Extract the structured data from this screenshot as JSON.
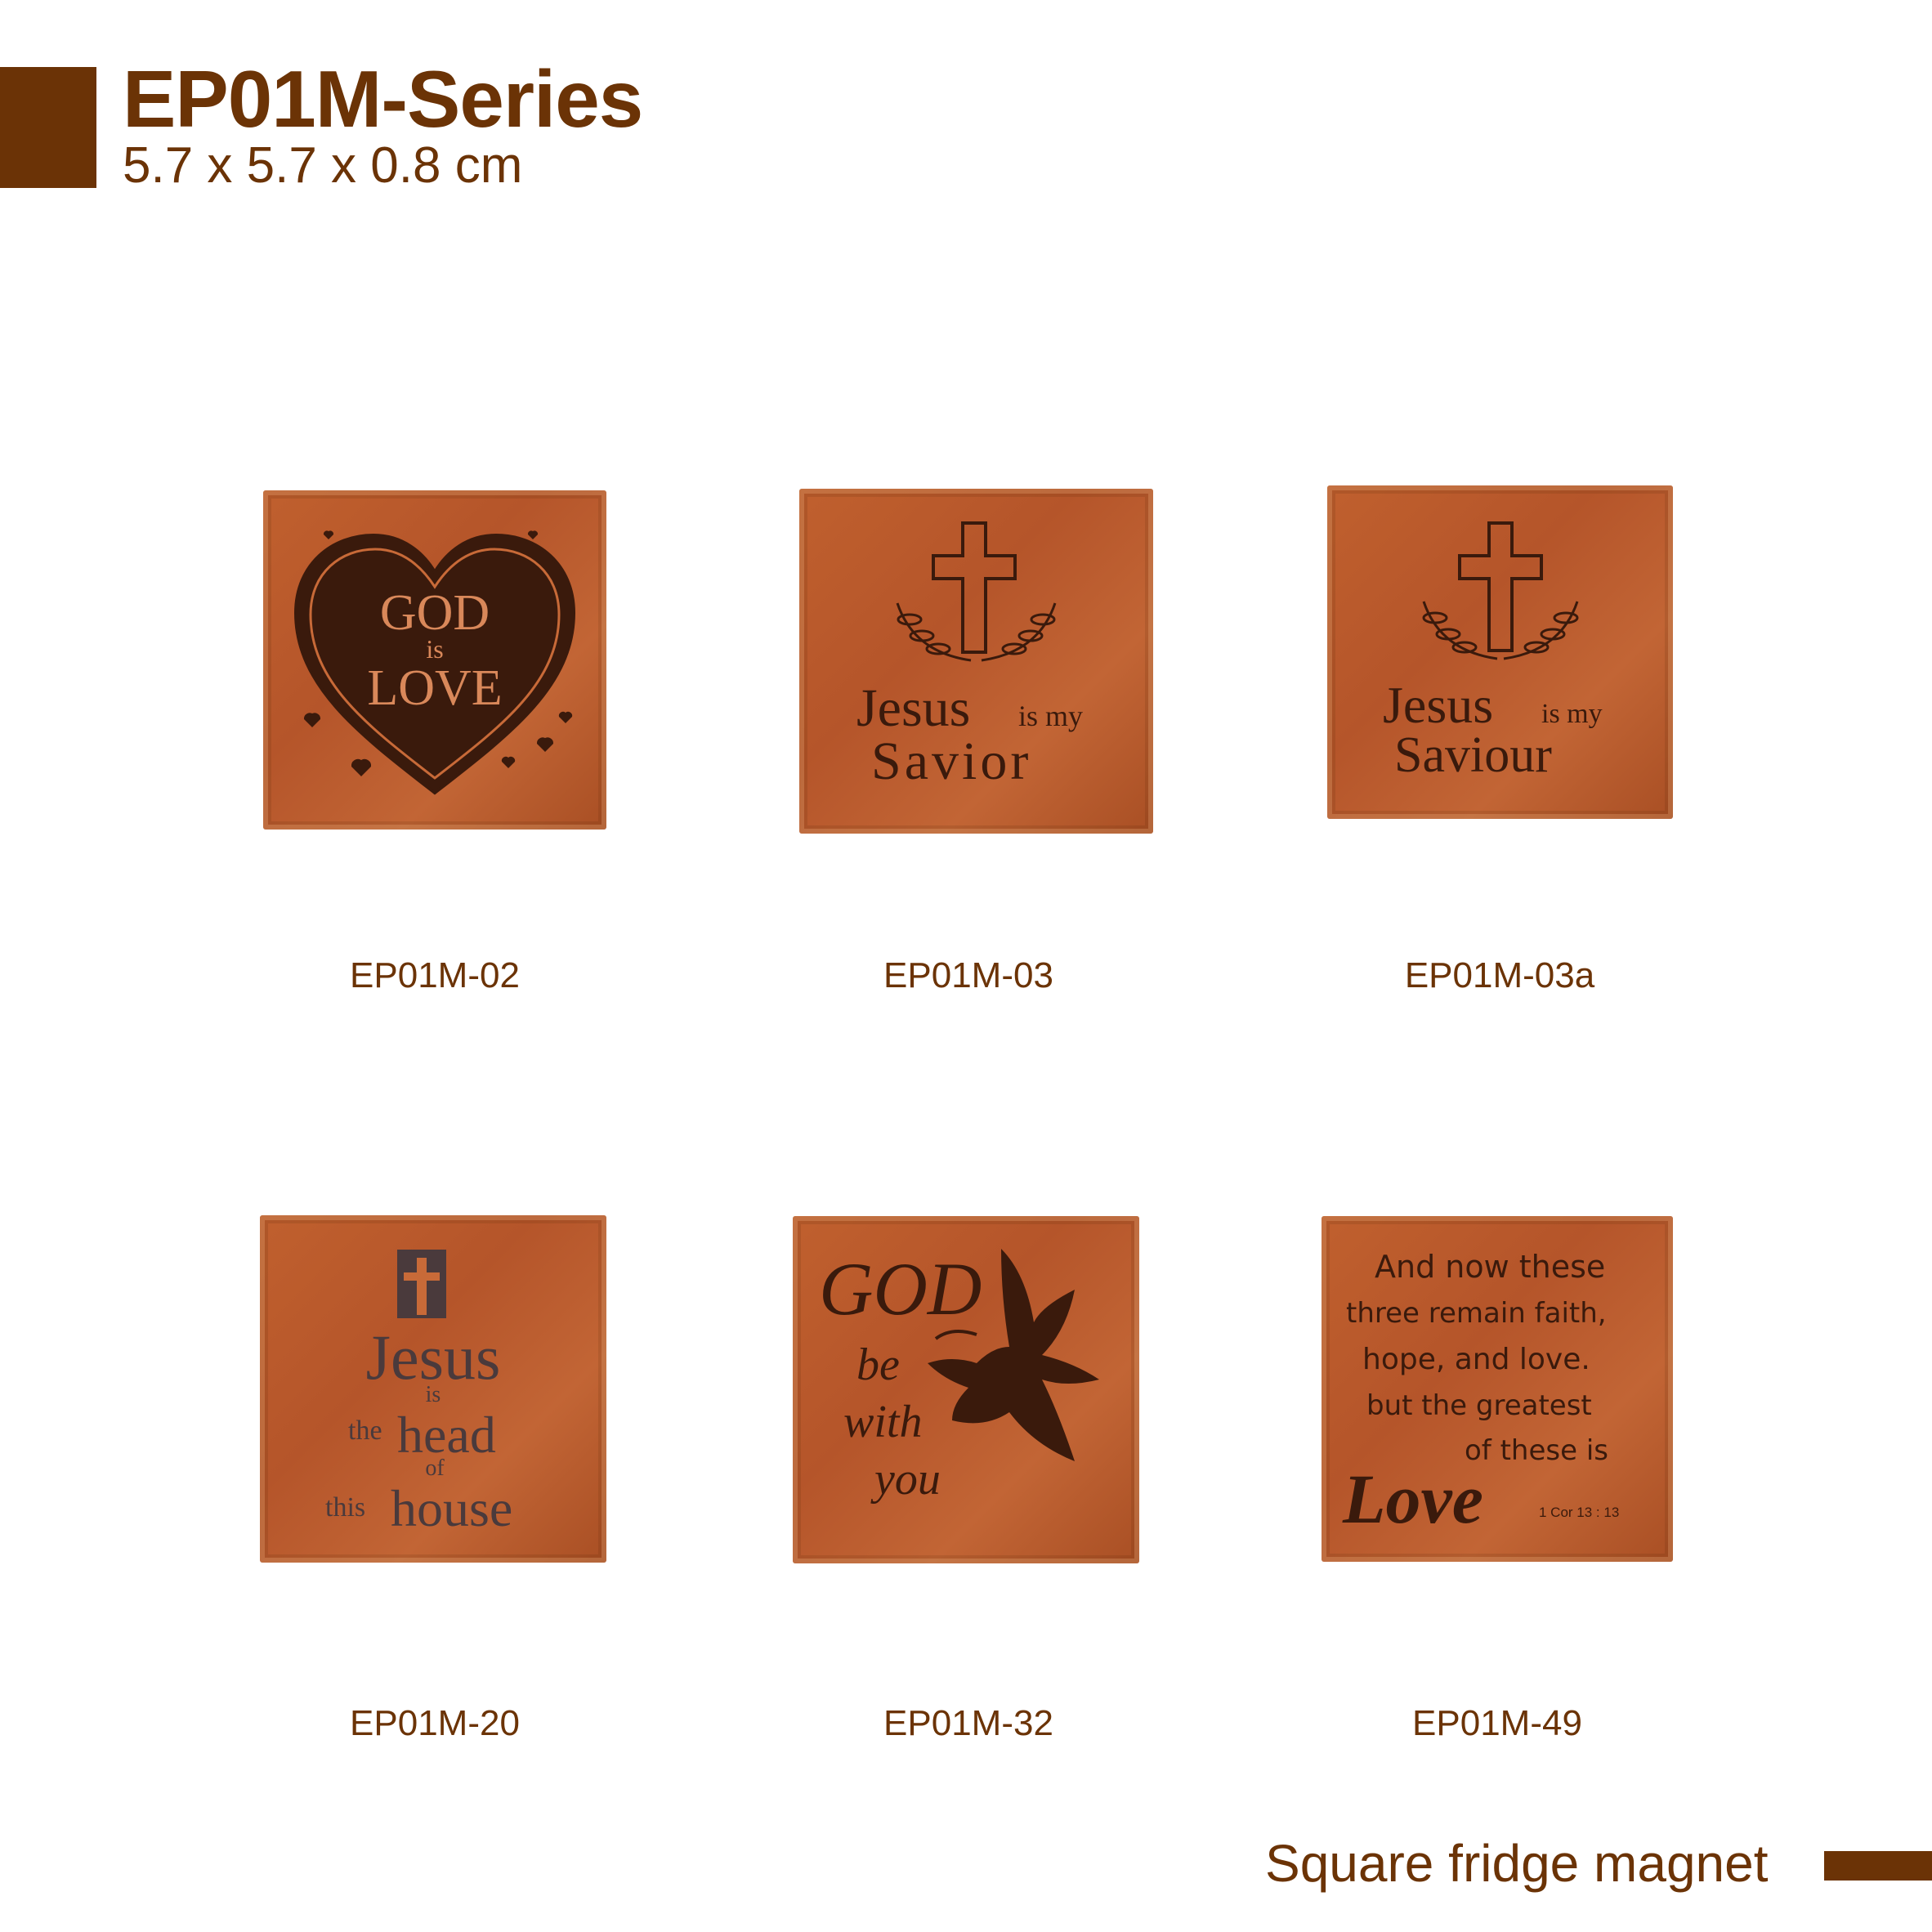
{
  "header": {
    "title": "EP01M-Series",
    "dimensions": "5.7 x 5.7 x 0.8 cm"
  },
  "products": [
    {
      "code": "EP01M-02",
      "engraving": [
        "GOD",
        "is",
        "LOVE"
      ]
    },
    {
      "code": "EP01M-03",
      "engraving": [
        "Jesus",
        "is my",
        "Savior"
      ]
    },
    {
      "code": "EP01M-03a",
      "engraving": [
        "Jesus",
        "is my",
        "Saviour"
      ]
    },
    {
      "code": "EP01M-20",
      "engraving": [
        "Jesus",
        "is",
        "the",
        "head",
        "of",
        "this",
        "house"
      ]
    },
    {
      "code": "EP01M-32",
      "engraving": [
        "GOD",
        "be",
        "with",
        "you"
      ]
    },
    {
      "code": "EP01M-49",
      "engraving": [
        "And now these",
        "three remain faith,",
        "hope, and love.",
        "but the greatest",
        "of these is",
        "Love",
        "1 Cor 13 : 13"
      ]
    }
  ],
  "footer": {
    "label": "Square fridge magnet"
  },
  "colors": {
    "brand": "#6b3306",
    "wood": "#b5552a",
    "engrave": "#3a1a0c"
  }
}
